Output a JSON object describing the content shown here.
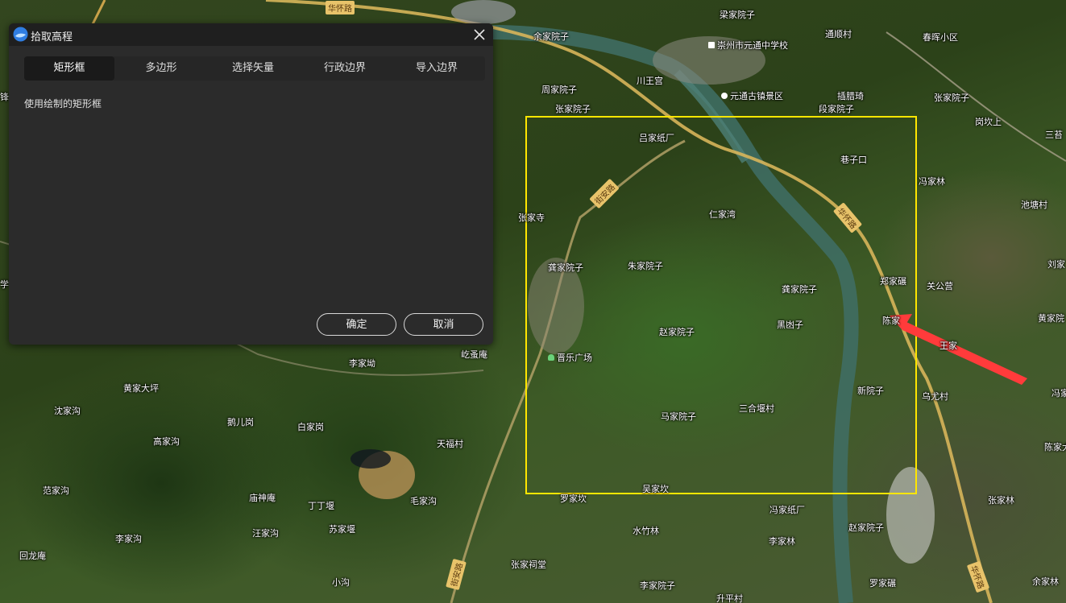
{
  "dialog": {
    "title": "拾取高程",
    "tabs": [
      {
        "label": "矩形框",
        "active": true
      },
      {
        "label": "多边形",
        "active": false
      },
      {
        "label": "选择矢量",
        "active": false
      },
      {
        "label": "行政边界",
        "active": false
      },
      {
        "label": "导入边界",
        "active": false
      }
    ],
    "description": "使用绘制的矩形框",
    "confirm_label": "确定",
    "cancel_label": "取消"
  },
  "map": {
    "road_labels": [
      "华怀路",
      "街安路",
      "华怀路",
      "街安路",
      "华怀路"
    ],
    "places": [
      "余家院子",
      "梁家院子",
      "通顺村",
      "崇州市元通中学校",
      "春晖小区",
      "周家院子",
      "川王宫",
      "元通古镇景区",
      "插腊琦",
      "张家院子",
      "张家院子",
      "段家院子",
      "岗坎上",
      "三苔",
      "吕家纸厂",
      "巷子口",
      "冯家林",
      "张家寺",
      "仁家湾",
      "池塘村",
      "龚家院子",
      "朱家院子",
      "郑家碾",
      "关公营",
      "龚家院子",
      "刘家",
      "赵家院子",
      "黑凼子",
      "陈家",
      "黄家院",
      "李家坳",
      "屹蚤庵",
      "晋乐广场",
      "王家",
      "乌尤村",
      "冯家",
      "黄家大坪",
      "新院子",
      "陈家大",
      "沈家沟",
      "白家岗",
      "三合堰村",
      "鹅儿岗",
      "马家院子",
      "高家沟",
      "天福村",
      "范家沟",
      "庙神庵",
      "毛家沟",
      "罗家坎",
      "吴家坎",
      "冯家纸厂",
      "张家林",
      "丁丁堰",
      "水竹林",
      "赵家院子",
      "李家沟",
      "汪家沟",
      "苏家堰",
      "李家林",
      "回龙庵",
      "张家祠堂",
      "余家林",
      "小沟",
      "李家院子",
      "罗家碾",
      "升平村",
      "锋",
      "学"
    ],
    "selection_rectangle_color": "#ffe600",
    "arrow_color": "#ff3b3b",
    "poi_icons": [
      "school-icon",
      "scenic-icon",
      "park-icon"
    ]
  }
}
